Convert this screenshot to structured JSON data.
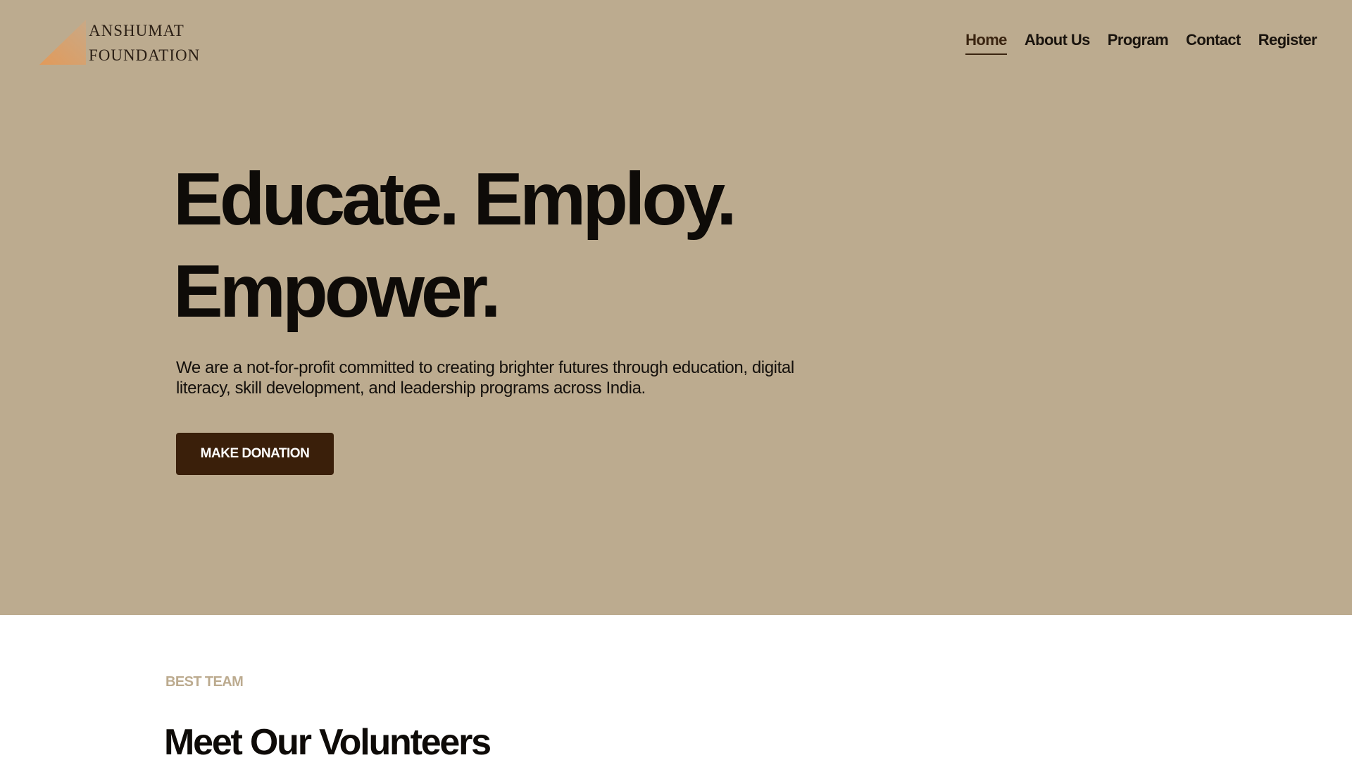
{
  "brand": {
    "name_line1": "ANSHUMAT",
    "name_line2": "FOUNDATION",
    "logo_gradient": [
      "#e29a5a",
      "#c9a986"
    ]
  },
  "nav": {
    "items": [
      {
        "label": "Home",
        "active": true
      },
      {
        "label": "About Us",
        "active": false
      },
      {
        "label": "Program",
        "active": false
      },
      {
        "label": "Contact",
        "active": false
      },
      {
        "label": "Register",
        "active": false
      }
    ]
  },
  "hero": {
    "headline_line1": "Educate. Employ.",
    "headline_line2": "Empower.",
    "description": "We are a not-for-profit committed to creating brighter futures through education, digital literacy, skill development, and leadership programs across India.",
    "cta_label": "MAKE DONATION",
    "background_color": "#bcab8f",
    "cta_color": "#3a1f0a"
  },
  "team": {
    "eyebrow": "BEST TEAM",
    "title": "Meet Our Volunteers"
  }
}
